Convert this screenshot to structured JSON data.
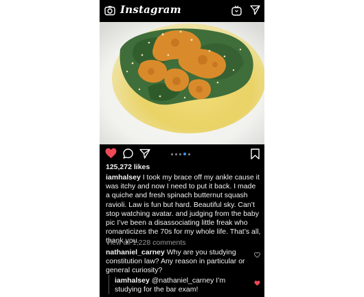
{
  "header": {
    "logo_text": "Instagram",
    "camera_icon": "camera-icon",
    "igtv_icon": "igtv-icon",
    "direct_icon": "paper-plane-icon"
  },
  "post": {
    "liked": true,
    "like_color": "#ed4956",
    "likes_label": "125,272 likes",
    "carousel": {
      "count": 5,
      "active_index": 3,
      "active_color": "#3897f0"
    },
    "caption": {
      "username": "iamhalsey",
      "text": "I took my brace off my ankle cause it was itchy and now I need to put it back. I made a quiche and fresh spinach butternut squash ravioli. Law is fun but hard. Beautiful sky. Can’t stop watching avatar. and judging from the baby pic I’ve been a disassociating little freak who romanticizes the 70s for my whole life. That’s all, thank you."
    },
    "view_all_label": "View all 1,228 comments",
    "comments": [
      {
        "username": "nathaniel_carney",
        "text": "Why are you studying constitution law? Any reason in particular or general curiosity?",
        "liked": false
      },
      {
        "username": "iamhalsey",
        "text": "@nathaniel_carney I’m studying for the bar exam!",
        "liked": true
      }
    ]
  }
}
